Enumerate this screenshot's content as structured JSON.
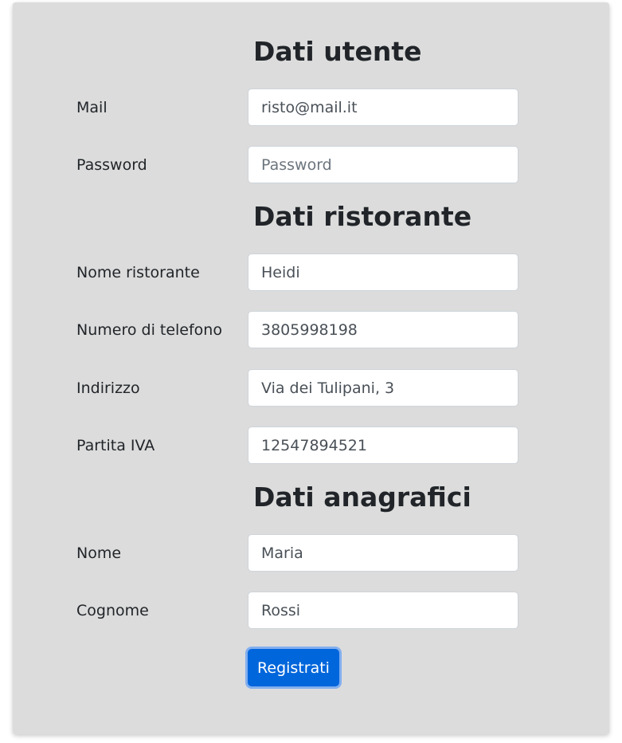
{
  "sections": {
    "user": {
      "title": "Dati utente",
      "mail": {
        "label": "Mail",
        "value": "risto@mail.it",
        "placeholder": ""
      },
      "password": {
        "label": "Password",
        "value": "",
        "placeholder": "Password"
      }
    },
    "restaurant": {
      "title": "Dati ristorante",
      "name": {
        "label": "Nome ristorante",
        "value": "Heidi"
      },
      "phone": {
        "label": "Numero di telefono",
        "value": "3805998198"
      },
      "address": {
        "label": "Indirizzo",
        "value": "Via dei Tulipani, 3"
      },
      "vat": {
        "label": "Partita IVA",
        "value": "12547894521"
      }
    },
    "personal": {
      "title": "Dati anagrafici",
      "first_name": {
        "label": "Nome",
        "value": "Maria"
      },
      "last_name": {
        "label": "Cognome",
        "value": "Rossi"
      }
    }
  },
  "submit_label": "Registrati",
  "colors": {
    "card_background": "#dcdcdc",
    "button_primary": "#0066db",
    "focus_ring": "#64a0f5"
  }
}
